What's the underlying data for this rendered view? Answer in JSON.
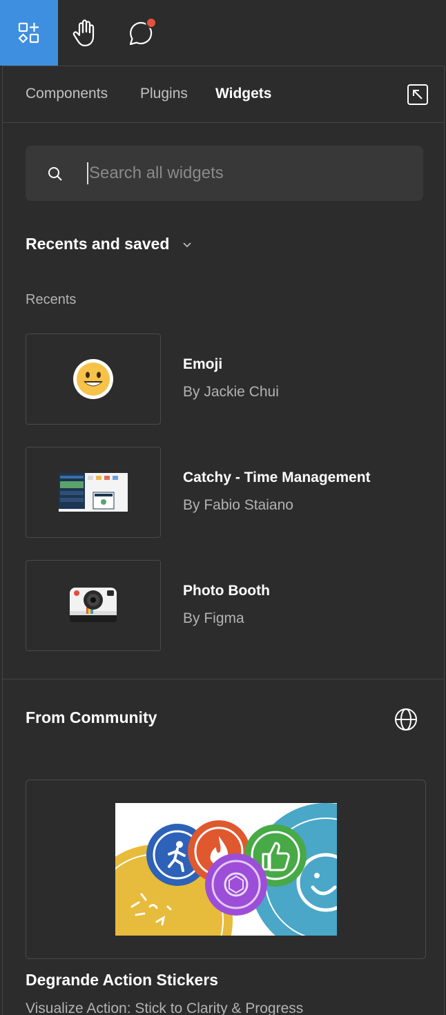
{
  "toolbar": {
    "tools": [
      {
        "name": "widgets-tool",
        "active": true
      },
      {
        "name": "hand-tool",
        "active": false
      },
      {
        "name": "comment-tool",
        "active": false,
        "notification": true
      }
    ],
    "accent_color": "#3f8fe0",
    "notification_color": "#e5533d"
  },
  "tabs": [
    {
      "label": "Components",
      "active": false
    },
    {
      "label": "Plugins",
      "active": false
    },
    {
      "label": "Widgets",
      "active": true
    }
  ],
  "search": {
    "placeholder": "Search all widgets",
    "value": ""
  },
  "recents_section": {
    "title": "Recents and saved",
    "subtitle": "Recents",
    "items": [
      {
        "name": "Emoji",
        "author": "By Jackie Chui",
        "icon": "smiley-emoji-icon"
      },
      {
        "name": "Catchy - Time Management",
        "author": "By Fabio Staiano",
        "icon": "app-screenshot-thumbnail"
      },
      {
        "name": "Photo Booth",
        "author": "By Figma",
        "icon": "instant-camera-icon"
      }
    ]
  },
  "community_section": {
    "title": "From Community",
    "featured": {
      "name": "Degrande Action Stickers",
      "description": "Visualize Action: Stick to Clarity & Progress"
    }
  }
}
